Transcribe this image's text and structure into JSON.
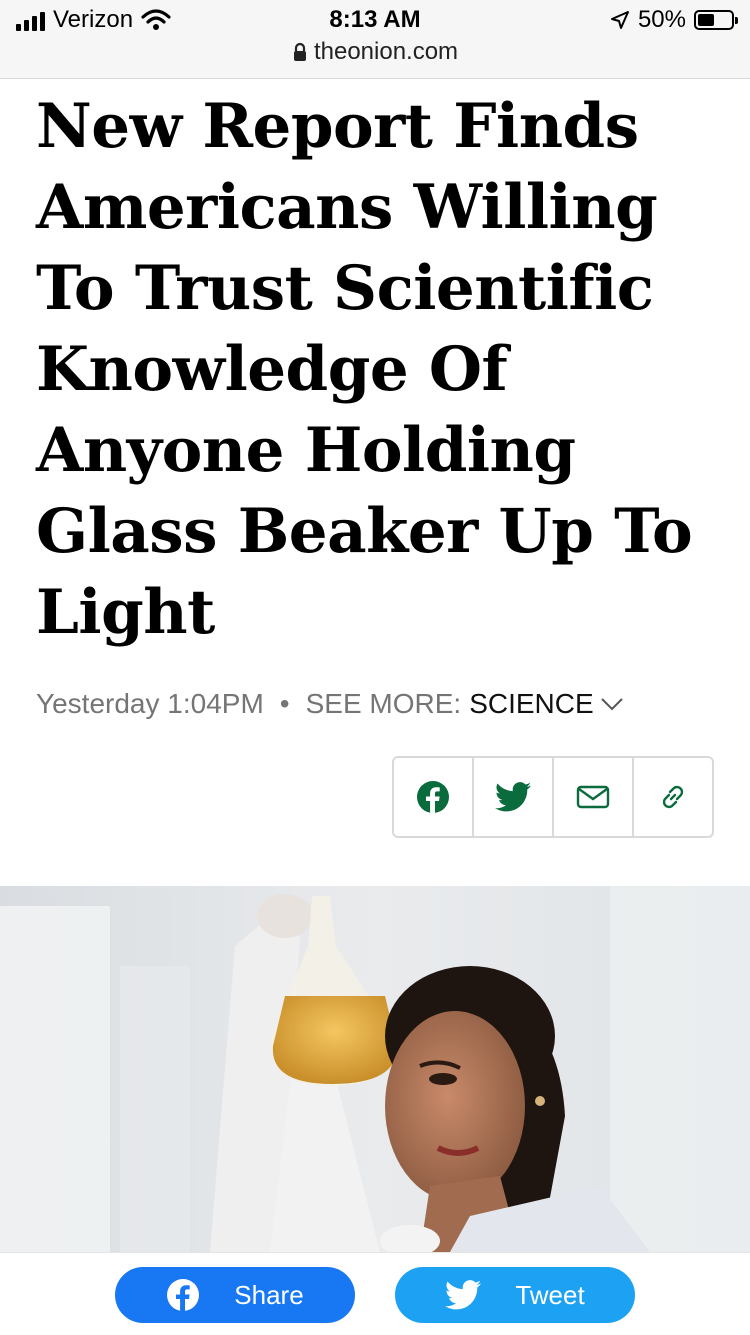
{
  "status_bar": {
    "carrier": "Verizon",
    "time": "8:13 AM",
    "battery": "50%",
    "battery_level": 0.5
  },
  "browser": {
    "url": "theonion.com"
  },
  "article": {
    "headline": "New Report Finds Americans Willing To Trust Scientific Knowledge Of Anyone Holding Glass Beaker Up To Light",
    "timestamp": "Yesterday 1:04PM",
    "separator": "•",
    "see_more_label": "SEE MORE:",
    "category": "SCIENCE"
  },
  "share_icons": [
    "facebook-icon",
    "twitter-icon",
    "mail-icon",
    "link-icon"
  ],
  "bottom_share": {
    "facebook_label": "Share",
    "twitter_label": "Tweet"
  },
  "colors": {
    "accent_green": "#0a6b3c",
    "facebook_blue": "#1877f2",
    "twitter_blue": "#1da1f2"
  }
}
